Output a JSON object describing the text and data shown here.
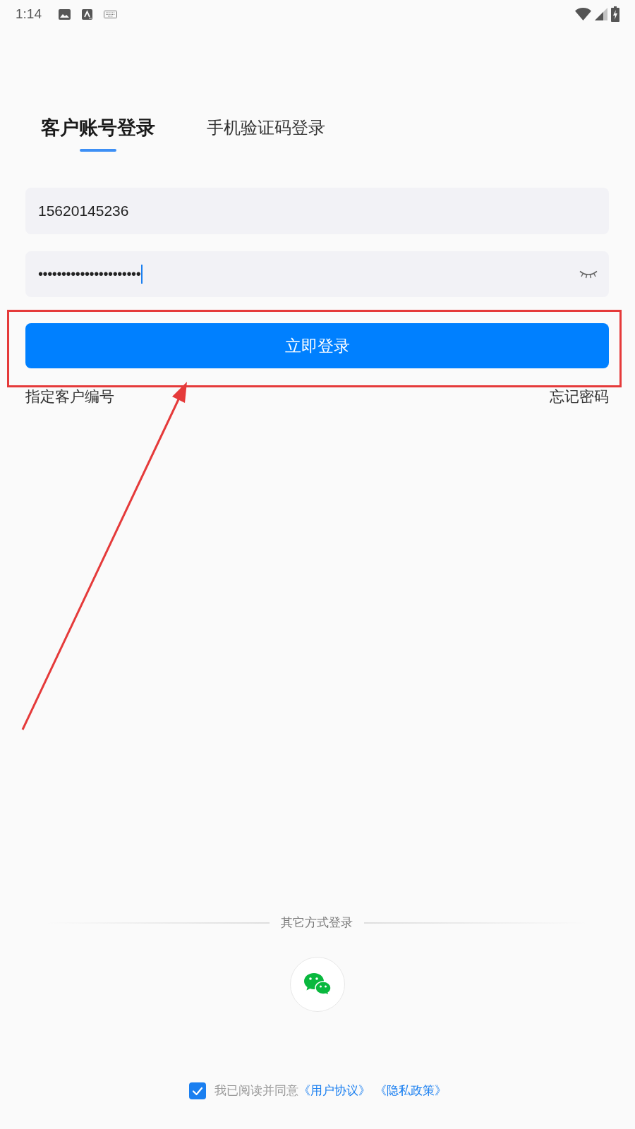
{
  "status_bar": {
    "time": "1:14"
  },
  "tabs": [
    {
      "label": "客户账号登录",
      "selected": true
    },
    {
      "label": "手机验证码登录",
      "selected": false
    }
  ],
  "account_field": {
    "value": "15620145236"
  },
  "password_field": {
    "value": "••••••••••••••••••••••",
    "focused": true,
    "visible": false
  },
  "login_button": {
    "label": "立即登录"
  },
  "links": [
    {
      "label": "指定客户编号"
    },
    {
      "label": "忘记密码"
    }
  ],
  "other_login": {
    "label": "其它方式登录"
  },
  "agreement": {
    "checked": true,
    "text": "我已阅读并同意",
    "links": [
      {
        "label": "《用户协议》"
      },
      {
        "label": "《隐私政策》"
      }
    ]
  }
}
